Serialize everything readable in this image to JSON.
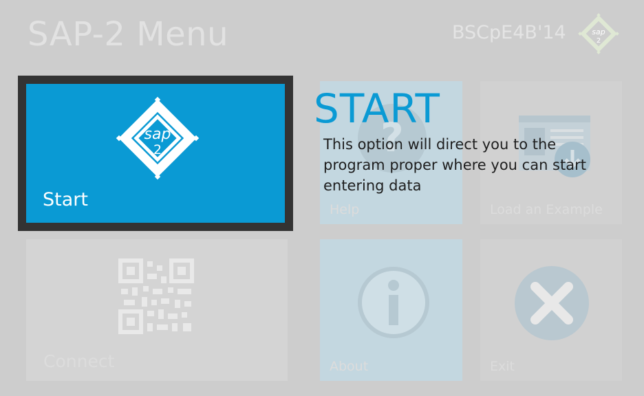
{
  "header": {
    "title": "SAP-2 Menu",
    "brand": "BSCpE4B'14",
    "brand_logo_text_top": "sap",
    "brand_logo_text_bottom": "2"
  },
  "tiles": {
    "start": {
      "label": "Start",
      "logo_text_top": "sap",
      "logo_text_bottom": "2",
      "icon": "sap2-logo-icon",
      "color": "#0a9ad4"
    },
    "help": {
      "label": "Help",
      "icon": "help-icon"
    },
    "load_example": {
      "label": "Load an Example",
      "icon": "load-example-icon"
    },
    "connect": {
      "label": "Connect",
      "icon": "qr-code-icon"
    },
    "about": {
      "label": "About",
      "icon": "info-icon"
    },
    "exit": {
      "label": "Exit",
      "icon": "close-icon"
    }
  },
  "tooltip": {
    "title": "START",
    "body": "This option will direct you to the program proper where you can start entering data"
  },
  "colors": {
    "accent": "#0a9ad4",
    "background": "#cdcdcd",
    "selection_border": "#333333"
  }
}
